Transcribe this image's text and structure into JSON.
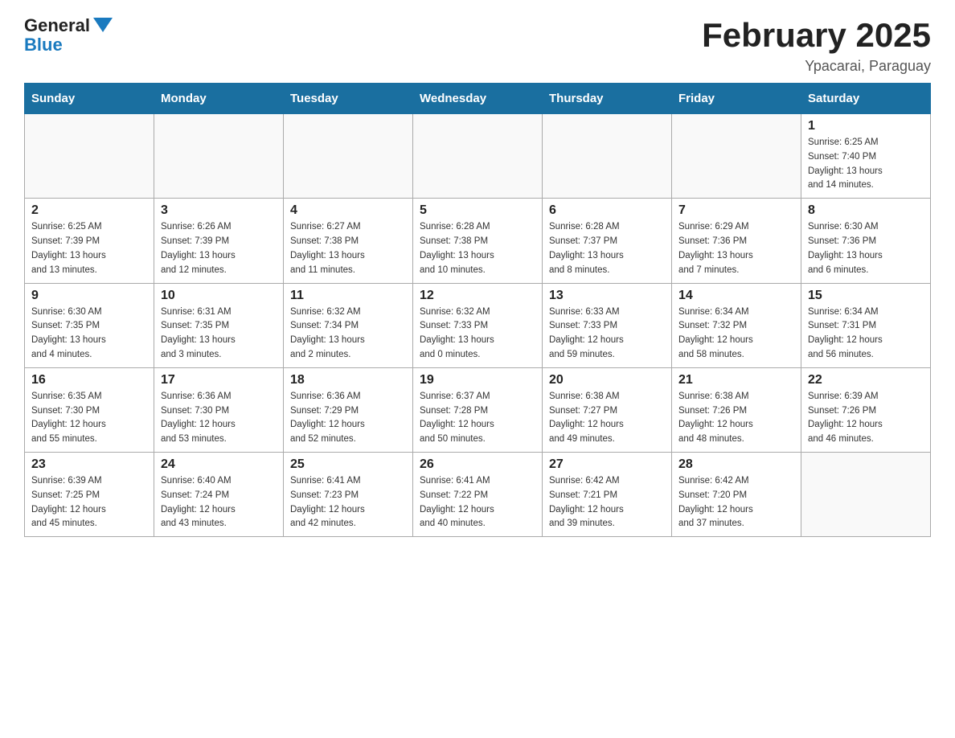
{
  "header": {
    "logo_general": "General",
    "logo_blue": "Blue",
    "title": "February 2025",
    "location": "Ypacarai, Paraguay"
  },
  "days_of_week": [
    "Sunday",
    "Monday",
    "Tuesday",
    "Wednesday",
    "Thursday",
    "Friday",
    "Saturday"
  ],
  "weeks": [
    [
      {
        "day": "",
        "info": ""
      },
      {
        "day": "",
        "info": ""
      },
      {
        "day": "",
        "info": ""
      },
      {
        "day": "",
        "info": ""
      },
      {
        "day": "",
        "info": ""
      },
      {
        "day": "",
        "info": ""
      },
      {
        "day": "1",
        "info": "Sunrise: 6:25 AM\nSunset: 7:40 PM\nDaylight: 13 hours\nand 14 minutes."
      }
    ],
    [
      {
        "day": "2",
        "info": "Sunrise: 6:25 AM\nSunset: 7:39 PM\nDaylight: 13 hours\nand 13 minutes."
      },
      {
        "day": "3",
        "info": "Sunrise: 6:26 AM\nSunset: 7:39 PM\nDaylight: 13 hours\nand 12 minutes."
      },
      {
        "day": "4",
        "info": "Sunrise: 6:27 AM\nSunset: 7:38 PM\nDaylight: 13 hours\nand 11 minutes."
      },
      {
        "day": "5",
        "info": "Sunrise: 6:28 AM\nSunset: 7:38 PM\nDaylight: 13 hours\nand 10 minutes."
      },
      {
        "day": "6",
        "info": "Sunrise: 6:28 AM\nSunset: 7:37 PM\nDaylight: 13 hours\nand 8 minutes."
      },
      {
        "day": "7",
        "info": "Sunrise: 6:29 AM\nSunset: 7:36 PM\nDaylight: 13 hours\nand 7 minutes."
      },
      {
        "day": "8",
        "info": "Sunrise: 6:30 AM\nSunset: 7:36 PM\nDaylight: 13 hours\nand 6 minutes."
      }
    ],
    [
      {
        "day": "9",
        "info": "Sunrise: 6:30 AM\nSunset: 7:35 PM\nDaylight: 13 hours\nand 4 minutes."
      },
      {
        "day": "10",
        "info": "Sunrise: 6:31 AM\nSunset: 7:35 PM\nDaylight: 13 hours\nand 3 minutes."
      },
      {
        "day": "11",
        "info": "Sunrise: 6:32 AM\nSunset: 7:34 PM\nDaylight: 13 hours\nand 2 minutes."
      },
      {
        "day": "12",
        "info": "Sunrise: 6:32 AM\nSunset: 7:33 PM\nDaylight: 13 hours\nand 0 minutes."
      },
      {
        "day": "13",
        "info": "Sunrise: 6:33 AM\nSunset: 7:33 PM\nDaylight: 12 hours\nand 59 minutes."
      },
      {
        "day": "14",
        "info": "Sunrise: 6:34 AM\nSunset: 7:32 PM\nDaylight: 12 hours\nand 58 minutes."
      },
      {
        "day": "15",
        "info": "Sunrise: 6:34 AM\nSunset: 7:31 PM\nDaylight: 12 hours\nand 56 minutes."
      }
    ],
    [
      {
        "day": "16",
        "info": "Sunrise: 6:35 AM\nSunset: 7:30 PM\nDaylight: 12 hours\nand 55 minutes."
      },
      {
        "day": "17",
        "info": "Sunrise: 6:36 AM\nSunset: 7:30 PM\nDaylight: 12 hours\nand 53 minutes."
      },
      {
        "day": "18",
        "info": "Sunrise: 6:36 AM\nSunset: 7:29 PM\nDaylight: 12 hours\nand 52 minutes."
      },
      {
        "day": "19",
        "info": "Sunrise: 6:37 AM\nSunset: 7:28 PM\nDaylight: 12 hours\nand 50 minutes."
      },
      {
        "day": "20",
        "info": "Sunrise: 6:38 AM\nSunset: 7:27 PM\nDaylight: 12 hours\nand 49 minutes."
      },
      {
        "day": "21",
        "info": "Sunrise: 6:38 AM\nSunset: 7:26 PM\nDaylight: 12 hours\nand 48 minutes."
      },
      {
        "day": "22",
        "info": "Sunrise: 6:39 AM\nSunset: 7:26 PM\nDaylight: 12 hours\nand 46 minutes."
      }
    ],
    [
      {
        "day": "23",
        "info": "Sunrise: 6:39 AM\nSunset: 7:25 PM\nDaylight: 12 hours\nand 45 minutes."
      },
      {
        "day": "24",
        "info": "Sunrise: 6:40 AM\nSunset: 7:24 PM\nDaylight: 12 hours\nand 43 minutes."
      },
      {
        "day": "25",
        "info": "Sunrise: 6:41 AM\nSunset: 7:23 PM\nDaylight: 12 hours\nand 42 minutes."
      },
      {
        "day": "26",
        "info": "Sunrise: 6:41 AM\nSunset: 7:22 PM\nDaylight: 12 hours\nand 40 minutes."
      },
      {
        "day": "27",
        "info": "Sunrise: 6:42 AM\nSunset: 7:21 PM\nDaylight: 12 hours\nand 39 minutes."
      },
      {
        "day": "28",
        "info": "Sunrise: 6:42 AM\nSunset: 7:20 PM\nDaylight: 12 hours\nand 37 minutes."
      },
      {
        "day": "",
        "info": ""
      }
    ]
  ]
}
